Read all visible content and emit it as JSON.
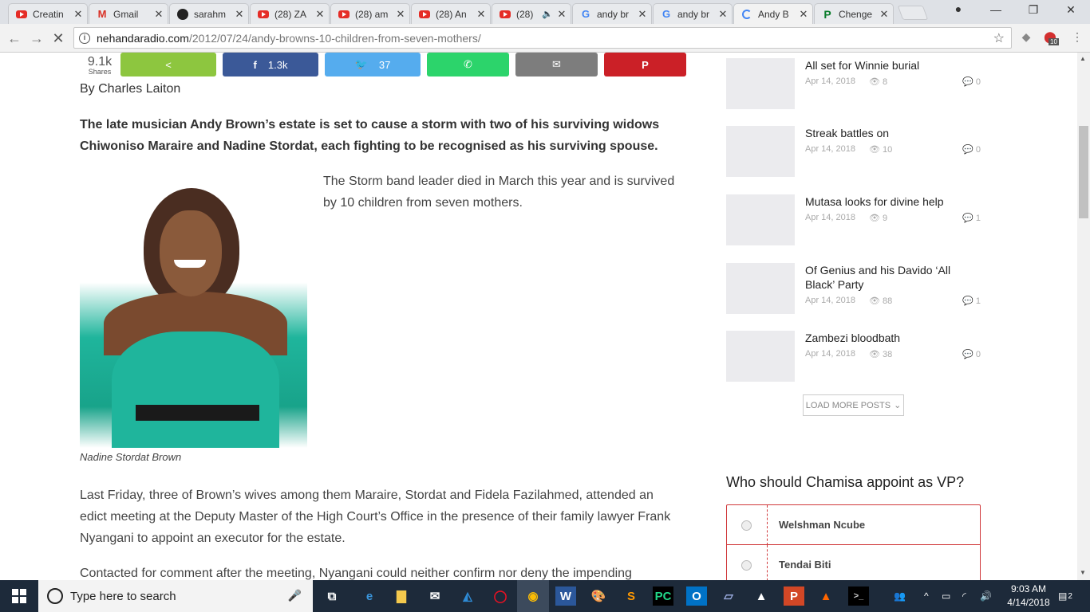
{
  "browser": {
    "tabs": [
      {
        "title": "Creatin",
        "icon": "youtube-icon"
      },
      {
        "title": "Gmail",
        "icon": "gmail-icon"
      },
      {
        "title": "sarahm",
        "icon": "github-icon"
      },
      {
        "title": "(28) ZA",
        "icon": "youtube-icon"
      },
      {
        "title": "(28) am",
        "icon": "youtube-icon"
      },
      {
        "title": "(28) An",
        "icon": "youtube-icon"
      },
      {
        "title": "(28)",
        "icon": "youtube-icon"
      },
      {
        "title": "andy br",
        "icon": "google-icon"
      },
      {
        "title": "andy br",
        "icon": "google-icon"
      },
      {
        "title": "Andy B",
        "icon": "loading-icon"
      },
      {
        "title": "Chenge",
        "icon": "pinterest-icon"
      }
    ],
    "url_host": "nehandaradio.com",
    "url_path": "/2012/07/24/andy-browns-10-children-from-seven-mothers/",
    "extension_badge": "10"
  },
  "article": {
    "share_count": "9.1k",
    "share_label": "Shares",
    "share_buttons": [
      {
        "network": "share",
        "count": "",
        "color": "#8dc63f"
      },
      {
        "network": "facebook",
        "count": "1.3k",
        "color": "#3b5998"
      },
      {
        "network": "twitter",
        "count": "37",
        "color": "#55acee"
      },
      {
        "network": "whatsapp",
        "count": "",
        "color": "#2cd46b"
      },
      {
        "network": "email",
        "count": "",
        "color": "#7d7d7d"
      },
      {
        "network": "pinterest",
        "count": "",
        "color": "#cb2027"
      }
    ],
    "byline": "By Charles Laiton",
    "lead": "The late musician Andy Brown’s estate is set to cause a storm with two of his surviving widows Chiwoniso Maraire and Nadine Stordat, each fighting to be recognised as his surviving spouse.",
    "float_paragraph": "The Storm band leader died in March this year and is survived by 10 children from seven mothers.",
    "image_caption": "Nadine Stordat Brown",
    "paragraph_1": "Last Friday, three of Brown’s wives among them Maraire, Stordat and Fidela Fazilahmed, attended an edict meeting at the Deputy Master of the High Court’s Office in the presence of their family lawyer Frank Nyangani to appoint an executor for the estate.",
    "paragraph_2": "Contacted for comment after the meeting, Nyangani could neither confirm nor deny the impending"
  },
  "sidebar": {
    "posts": [
      {
        "title": "All set for Winnie burial",
        "date": "Apr 14, 2018",
        "views": "8",
        "comments": "0"
      },
      {
        "title": "Streak battles on",
        "date": "Apr 14, 2018",
        "views": "10",
        "comments": "0"
      },
      {
        "title": "Mutasa looks for divine help",
        "date": "Apr 14, 2018",
        "views": "9",
        "comments": "1"
      },
      {
        "title": "Of Genius and his Davido ‘All Black’ Party",
        "date": "Apr 14, 2018",
        "views": "88",
        "comments": "1"
      },
      {
        "title": "Zambezi bloodbath",
        "date": "Apr 14, 2018",
        "views": "38",
        "comments": "0"
      }
    ],
    "load_more": "LOAD MORE POSTS",
    "poll_title": "Who should Chamisa appoint as VP?",
    "poll_options": [
      "Welshman Ncube",
      "Tendai Biti"
    ]
  },
  "taskbar": {
    "search_placeholder": "Type here to search",
    "time": "9:03 AM",
    "date": "4/14/2018",
    "notifications": "2"
  }
}
